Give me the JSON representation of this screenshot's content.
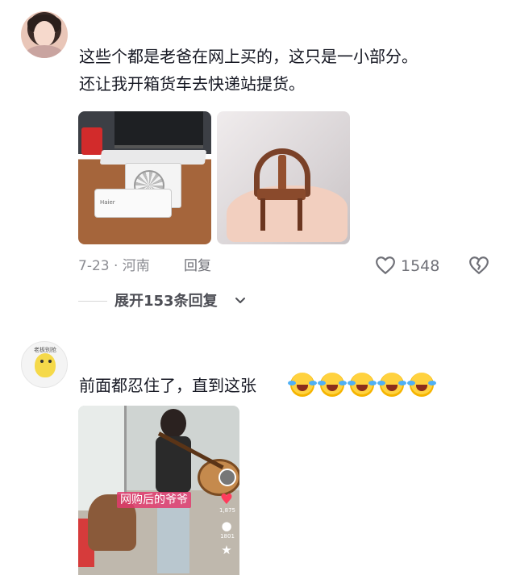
{
  "comments": [
    {
      "text_lines": [
        "这些个都是老爸在网上买的，这只是一小部分。",
        "还让我开箱货车去快递站提货。"
      ],
      "images": [
        "air-conditioner-model-photo",
        "miniature-chair-photo"
      ],
      "meta": {
        "date_location": "7-23 · 河南",
        "reply_label": "回复"
      },
      "like_count": "1548",
      "expand_label": "展开153条回复"
    },
    {
      "avatar_text": "老板别抢",
      "text": "前面都忍住了，直到这张",
      "emoji_count": 5,
      "emoji_name": "laughing-crying-emoji",
      "image": {
        "caption": "网购后的爷爷",
        "side_like_count": "1,875",
        "side_comment_count": "1801"
      }
    }
  ],
  "icons": {
    "like": "heart-outline-icon",
    "dislike": "broken-heart-icon",
    "expand": "chevron-down-icon"
  },
  "colors": {
    "text_primary": "#161823",
    "text_meta": "#8a8b91",
    "caption_bg": "#e03c6e"
  }
}
